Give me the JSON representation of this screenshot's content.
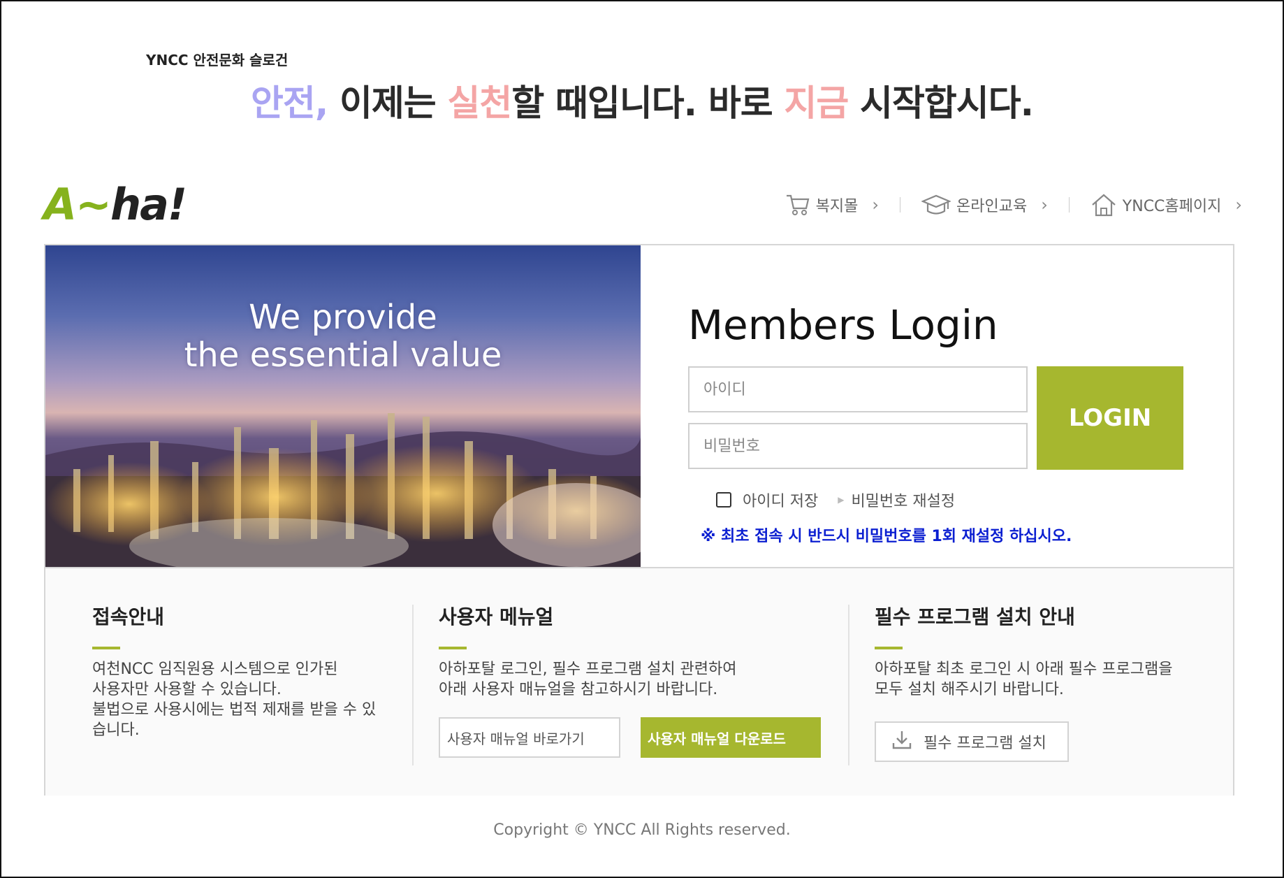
{
  "slogan": {
    "caption": "YNCC 안전문화 슬로건",
    "part1": "안전,",
    "part2": " 이제는 ",
    "part3": "실천",
    "part4": "할 때입니다. 바로 ",
    "part5": "지금",
    "part6": " 시작합시다."
  },
  "logo": {
    "a": "A",
    "tilde": "~",
    "rest": "ha!"
  },
  "nav": {
    "items": [
      {
        "label": "복지몰",
        "icon": "cart-icon"
      },
      {
        "label": "온라인교육",
        "icon": "graduation-cap-icon"
      },
      {
        "label": "YNCC홈페이지",
        "icon": "home-icon"
      }
    ],
    "chevron": "›"
  },
  "hero": {
    "line1": "We provide",
    "line2": "the essential value"
  },
  "login": {
    "title": "Members Login",
    "id_placeholder": "아이디",
    "pw_placeholder": "비밀번호",
    "button": "LOGIN",
    "save_id": "아이디 저장",
    "reset_pw": "비밀번호 재설정",
    "notice": "※ 최초 접속 시 반드시 비밀번호를 1회 재설정 하십시오."
  },
  "info": {
    "access": {
      "title": "접속안내",
      "desc": "여천NCC 임직원용 시스템으로 인가된\n사용자만 사용할 수 있습니다.\n불법으로 사용시에는 법적 제재를 받을 수 있\n습니다."
    },
    "manual": {
      "title": "사용자 메뉴얼",
      "desc": "아하포탈 로그인, 필수 프로그램 설치 관련하여\n아래 사용자 매뉴얼을 참고하시기 바랍니다.",
      "shortcut": "사용자 매뉴얼 바로가기",
      "download": "사용자 매뉴얼 다운로드"
    },
    "programs": {
      "title": "필수 프로그램 설치 안내",
      "desc": "아하포탈 최초 로그인 시 아래 필수 프로그램을\n모두 설치 해주시기 바랍니다.",
      "install": "필수 프로그램 설치"
    }
  },
  "footer": {
    "copyright": "Copyright ©  YNCC  All Rights reserved."
  },
  "colors": {
    "accent_green": "#a6b72f",
    "notice_blue": "#0b1fd1",
    "slogan_blue": "#a9a4f2",
    "slogan_pink": "#f4a5a5"
  }
}
